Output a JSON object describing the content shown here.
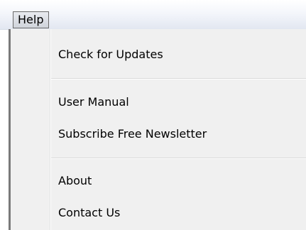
{
  "menubar": {
    "items": [
      {
        "label": "Help"
      }
    ]
  },
  "menu": {
    "items": [
      {
        "label": "Check for Updates"
      },
      {
        "label": "User Manual"
      },
      {
        "label": "Subscribe Free Newsletter"
      },
      {
        "label": "About"
      },
      {
        "label": "Contact Us"
      }
    ]
  }
}
